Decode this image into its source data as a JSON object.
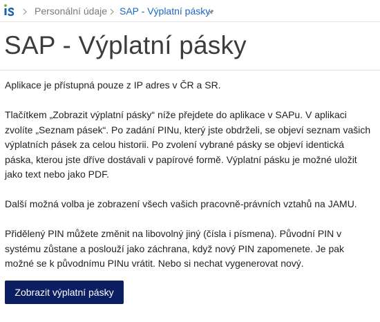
{
  "breadcrumb": {
    "logo_icon": "is-logo-icon",
    "items": [
      {
        "label": "Personální údaje"
      },
      {
        "label": "SAP - Výplatní pásky"
      }
    ],
    "pin_icon": "pin-icon"
  },
  "page": {
    "title": "SAP - Výplatní pásky"
  },
  "content": {
    "paragraphs": [
      "Aplikace je přístupná pouze z IP adres v ČR a SR.",
      "Tlačítkem „Zobrazit výplatní pásky“ níže přejdete do aplikace v SAPu. V aplikaci zvolíte „Seznam pásek“. Po zadání PINu, který jste obdrželi, se objeví seznam vašich výplatních pásek za celou historii. Po zvolení vybrané pásky se objeví identická páska, kterou jste dříve dostávali v papírové formě. Výplatní pásku je možné uložit jako text nebo jako PDF.",
      "Další možná volba je zobrazení všech vašich pracovně-právních vztahů na JAMU.",
      "Přidělený PIN můžete změnit na libovolný jiný (čísla i písmena). Původní PIN v systému zůstane a poslouží jako záchrana, když nový PIN zapomenete. Je pak možné se k původnímu PINu vrátit. Nebo si nechat vygenerovat nový."
    ]
  },
  "actions": {
    "show_payslips_label": "Zobrazit výplatní pásky"
  },
  "colors": {
    "accent_link": "#1a66c4",
    "button_background": "#0c1e62",
    "logo_green": "#6cc04a",
    "logo_blue": "#1b5fad"
  }
}
